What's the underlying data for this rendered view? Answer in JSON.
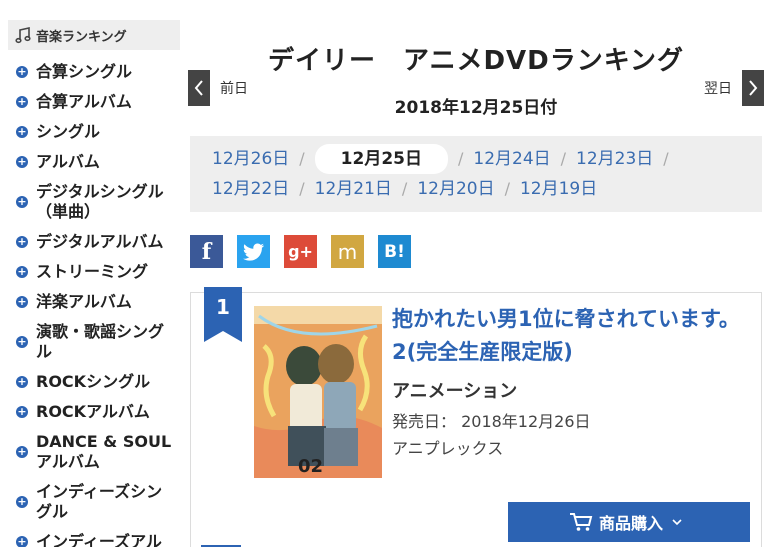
{
  "sidebar": {
    "heading": "音楽ランキング",
    "items": [
      {
        "label": "合算シングル"
      },
      {
        "label": "合算アルバム"
      },
      {
        "label": "シングル"
      },
      {
        "label": "アルバム"
      },
      {
        "label": "デジタルシングル（単曲）"
      },
      {
        "label": "デジタルアルバム"
      },
      {
        "label": "ストリーミング"
      },
      {
        "label": "洋楽アルバム"
      },
      {
        "label": "演歌・歌謡シングル"
      },
      {
        "label": "ROCKシングル"
      },
      {
        "label": "ROCKアルバム"
      },
      {
        "label": "DANCE & SOUL アルバム"
      },
      {
        "label": "インディーズシングル"
      },
      {
        "label": "インディーズアル"
      }
    ]
  },
  "header": {
    "title": "デイリー　アニメDVDランキング",
    "date": "2018年12月25日付",
    "prev_label": "前日",
    "next_label": "翌日",
    "dates": [
      "12月26日",
      "12月25日",
      "12月24日",
      "12月23日",
      "12月22日",
      "12月21日",
      "12月20日",
      "12月19日"
    ],
    "active_date": "12月25日"
  },
  "social": {
    "facebook": "f",
    "google": "g+",
    "mixi": "m",
    "hatena": "B!"
  },
  "item": {
    "rank": "1",
    "title": "抱かれたい男1位に脅されています。 2(完全生産限定版)",
    "genre": "アニメーション",
    "release": "発売日： 2018年12月26日",
    "maker": "アニプレックス",
    "buy_label": "商品購入",
    "cover_text": "02"
  },
  "colors": {
    "accent": "#2c63b3",
    "panel": "#eeeeee"
  }
}
